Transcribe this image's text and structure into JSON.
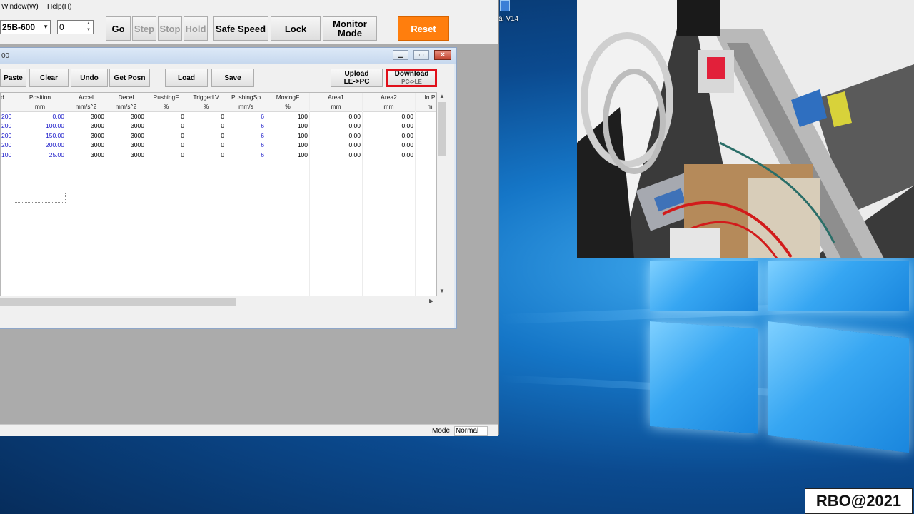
{
  "menu": {
    "window": "Window(W)",
    "help": "Help(H)"
  },
  "toolbar": {
    "model_select": "25B-600",
    "step_value": "0",
    "go": "Go",
    "step": "Step",
    "stop": "Stop",
    "hold": "Hold",
    "safe_speed": "Safe Speed",
    "lock": "Lock",
    "monitor_mode_1": "Monitor",
    "monitor_mode_2": "Mode",
    "reset": "Reset",
    "reset_color": "#ff7e0d"
  },
  "child": {
    "title": "00",
    "buttons": {
      "paste": "Paste",
      "clear": "Clear",
      "undo": "Undo",
      "get_posn": "Get Posn",
      "load": "Load",
      "save": "Save",
      "upload_1": "Upload",
      "upload_2": "LE->PC",
      "download_1": "Download",
      "download_2": "PC->LE"
    },
    "highlight_color": "#e0101a"
  },
  "grid": {
    "columns": [
      "d",
      "Position",
      "Accel",
      "Decel",
      "PushingF",
      "TriggerLV",
      "PushingSp",
      "MovingF",
      "Area1",
      "Area2",
      "In P"
    ],
    "units": [
      "",
      "mm",
      "mm/s^2",
      "mm/s^2",
      "%",
      "%",
      "mm/s",
      "%",
      "mm",
      "mm",
      "m"
    ],
    "rows": [
      [
        "200",
        "0.00",
        "3000",
        "3000",
        "0",
        "0",
        "6",
        "100",
        "0.00",
        "0.00"
      ],
      [
        "200",
        "100.00",
        "3000",
        "3000",
        "0",
        "0",
        "6",
        "100",
        "0.00",
        "0.00"
      ],
      [
        "200",
        "150.00",
        "3000",
        "3000",
        "0",
        "0",
        "6",
        "100",
        "0.00",
        "0.00"
      ],
      [
        "200",
        "200.00",
        "3000",
        "3000",
        "0",
        "0",
        "6",
        "100",
        "0.00",
        "0.00"
      ],
      [
        "100",
        "25.00",
        "3000",
        "3000",
        "0",
        "0",
        "6",
        "100",
        "0.00",
        "0.00"
      ]
    ]
  },
  "status": {
    "mode_label": "Mode",
    "mode_value": "Normal"
  },
  "desktop": {
    "icon_label": "al V14"
  },
  "watermark": "RBO@2021"
}
